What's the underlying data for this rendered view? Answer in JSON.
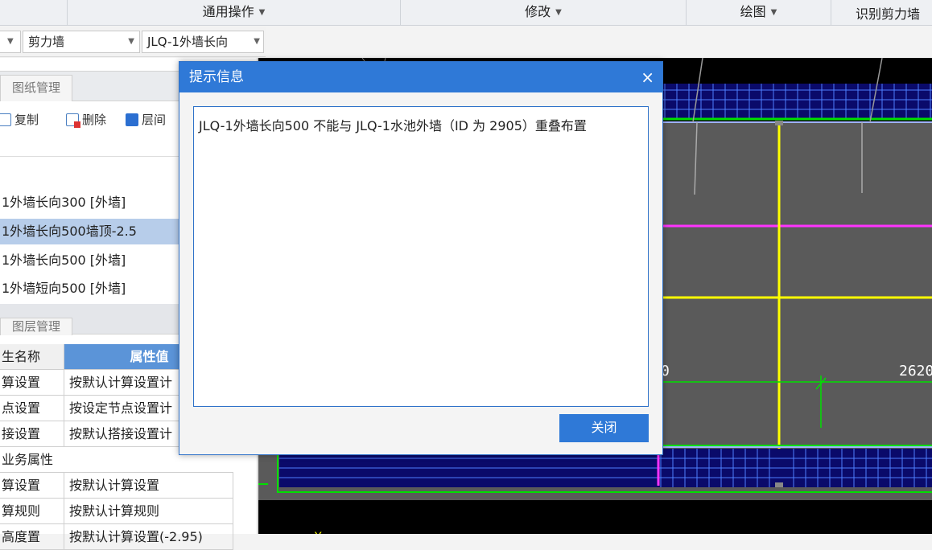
{
  "menubar": {
    "items": [
      {
        "label": "通用操作"
      },
      {
        "label": "修改"
      },
      {
        "label": "绘图"
      },
      {
        "label": "识别剪力墙"
      }
    ]
  },
  "toolbar": {
    "select1_value": "",
    "select2_value": "剪力墙",
    "select3_value": "JLQ-1外墙长向"
  },
  "left_panel": {
    "drawing_tab": "图纸管理",
    "actions": {
      "copy": "复制",
      "delete": "删除",
      "floor": "层间"
    },
    "wall_list": [
      {
        "label": "1外墙长向300 [外墙]",
        "selected": false
      },
      {
        "label": "1外墙长向500墙顶-2.5",
        "selected": true
      },
      {
        "label": "1外墙长向500 [外墙]",
        "selected": false
      },
      {
        "label": "1外墙短向500 [外墙]",
        "selected": false
      }
    ],
    "layer_tab": "图层管理",
    "property_grid": {
      "header": {
        "name": "生名称",
        "value": "属性值"
      },
      "rows": [
        {
          "name": "算设置",
          "value": "按默认计算设置计"
        },
        {
          "name": "点设置",
          "value": "按设定节点设置计"
        },
        {
          "name": "接设置",
          "value": "按默认搭接设置计"
        },
        {
          "name": "业务属性",
          "value": ""
        },
        {
          "name": "算设置",
          "value": "按默认计算设置"
        },
        {
          "name": "算规则",
          "value": "按默认计算规则"
        },
        {
          "name": "高度置",
          "value": "按默认计算设置(-2.95)"
        }
      ]
    }
  },
  "canvas": {
    "dimension_label_1": "2620",
    "dimension_label_2": "0",
    "axis_label": "Y"
  },
  "dialog": {
    "title": "提示信息",
    "close_glyph": "×",
    "message": "JLQ-1外墙长向500 不能与 JLQ-1水池外墙（ID 为 2905）重叠布置",
    "close_button": "关闭"
  },
  "colors": {
    "accent": "#2f79d7",
    "selection": "#b7cdea",
    "canvas_bg": "#000000",
    "wall_fill": "#5a5a5a",
    "cad_yellow": "#ffff00",
    "cad_magenta": "#ff33ff",
    "cad_green": "#00e000",
    "cad_blue": "#4d7fff"
  }
}
